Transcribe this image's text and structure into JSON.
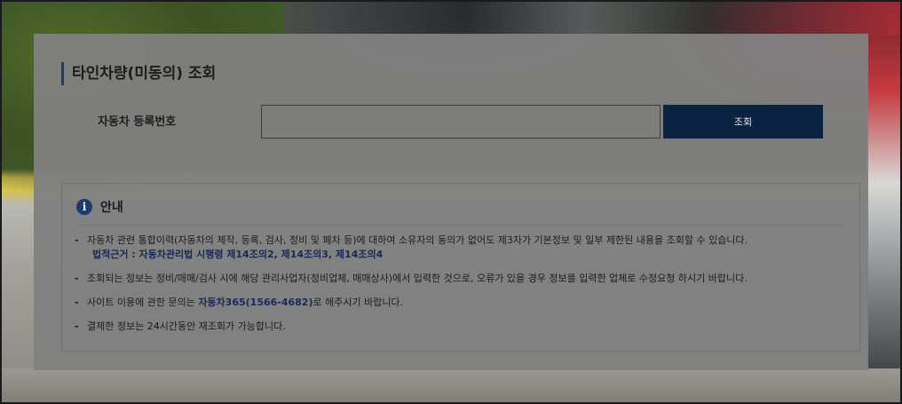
{
  "page": {
    "title": "타인차량(미동의) 조회"
  },
  "search": {
    "label": "자동차 등록번호",
    "value": "",
    "placeholder": "",
    "button_label": "조회"
  },
  "info": {
    "icon": "info-icon",
    "icon_glyph": "i",
    "title": "안내",
    "notes": [
      {
        "text": "자동차 관련 통합이력(자동차의 제작, 등록, 검사, 정비 및 폐차 등)에 대하여 소유자의 동의가 없어도 제3자가 기본정보 및 일부 제한된 내용을 조회할 수 있습니다.",
        "basis": "법적근거 : 자동차관리법 시행령 제14조의2, 제14조의3, 제14조의4"
      },
      {
        "text": "조회되는 정보는 정비/매매/검사 시에 해당 관리사업자(정비업체, 매매상사)에서 입력한 것으로, 오류가 있을 경우 정보를 입력한 업체로 수정요청 하시기 바랍니다."
      },
      {
        "prefix": "사이트 이용에 관한 문의는 ",
        "highlight": "자동차365(1566-4682)",
        "suffix": "로 해주시기 바랍니다."
      },
      {
        "text": "결제한 정보는 24시간동안 재조회가 가능합니다."
      }
    ]
  },
  "colors": {
    "accent": "#1d3a6b",
    "button": "#0b2342",
    "panel": "#808080"
  }
}
